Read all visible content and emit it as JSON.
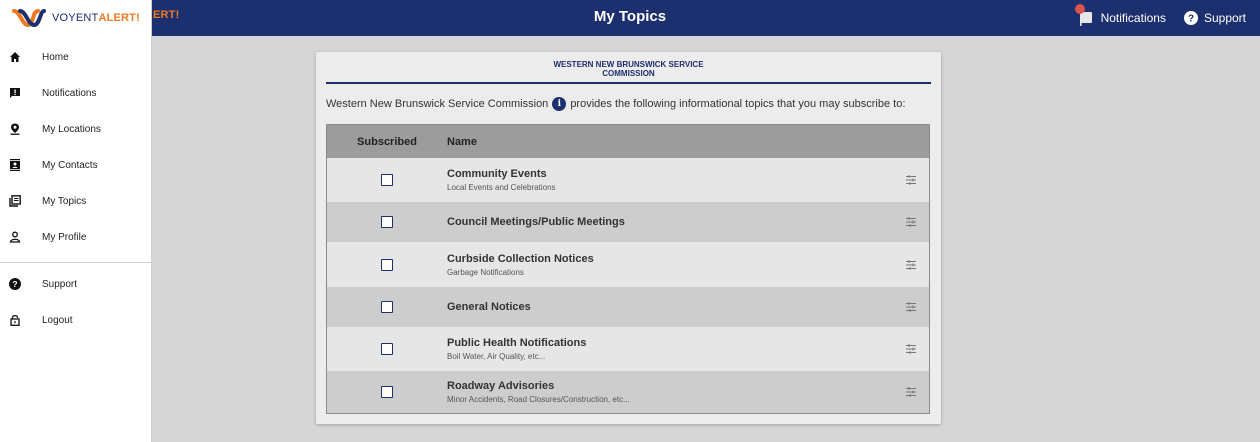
{
  "header": {
    "brand_peek": "ERT!",
    "title": "My Topics",
    "notifications_label": "Notifications",
    "support_label": "Support"
  },
  "sidebar": {
    "logo": {
      "word1": "VOYENT",
      "word2": "ALERT!"
    },
    "items": [
      {
        "label": "Home",
        "icon": "home-icon"
      },
      {
        "label": "Notifications",
        "icon": "alert-message-icon"
      },
      {
        "label": "My Locations",
        "icon": "location-pin-icon"
      },
      {
        "label": "My Contacts",
        "icon": "contacts-icon"
      },
      {
        "label": "My Topics",
        "icon": "topics-icon"
      },
      {
        "label": "My Profile",
        "icon": "profile-icon"
      }
    ],
    "bottom_items": [
      {
        "label": "Support",
        "icon": "help-icon"
      },
      {
        "label": "Logout",
        "icon": "lock-icon"
      }
    ]
  },
  "card": {
    "title_line1": "WESTERN NEW BRUNSWICK SERVICE",
    "title_line2": "COMMISSION",
    "intro_org": "Western New Brunswick Service Commission",
    "intro_text": "provides the following informational topics that you may subscribe to:",
    "col_subscribed": "Subscribed",
    "col_name": "Name",
    "topics": [
      {
        "name": "Community Events",
        "desc": "Local Events and Celebrations",
        "subscribed": false
      },
      {
        "name": "Council Meetings/Public Meetings",
        "desc": "",
        "subscribed": false
      },
      {
        "name": "Curbside Collection Notices",
        "desc": "Garbage Notifications",
        "subscribed": false
      },
      {
        "name": "General Notices",
        "desc": "",
        "subscribed": false
      },
      {
        "name": "Public Health Notifications",
        "desc": "Boil Water, Air Quality, etc...",
        "subscribed": false
      },
      {
        "name": "Roadway Advisories",
        "desc": "Minor Accidents, Road Closures/Construction, etc...",
        "subscribed": false
      }
    ]
  },
  "colors": {
    "navy": "#1c2f6e",
    "orange": "#f0781e"
  }
}
